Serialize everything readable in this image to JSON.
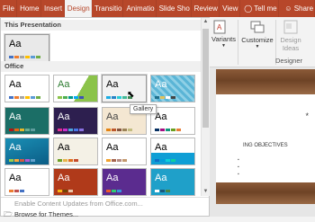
{
  "tabs": [
    "File",
    "Home",
    "Insert",
    "Design",
    "Transitions",
    "Animations",
    "Slide Show",
    "Review",
    "View"
  ],
  "tabs_display": [
    "File",
    "Home",
    "Insert",
    "Design",
    "Transitio",
    "Animatio",
    "Slide Sho",
    "Review",
    "View"
  ],
  "tell_me": "Tell me",
  "share": "Share",
  "ribbon": {
    "variants": "Variants",
    "customize": "Customize",
    "design_ideas_1": "Design",
    "design_ideas_2": "Ideas",
    "group_label": "Designer"
  },
  "gallery": {
    "this_presentation": "This Presentation",
    "office": "Office",
    "tooltip": "Gallery",
    "enable_updates": "Enable Content Updates from Office.com...",
    "browse_themes": "Browse for Themes..."
  },
  "slide": {
    "title": "ING OBJECTIVES",
    "bullets": [
      "",
      "",
      ""
    ],
    "star": "*"
  },
  "themes_aa": "Aa",
  "colors": {
    "accent": "#b7472a"
  }
}
